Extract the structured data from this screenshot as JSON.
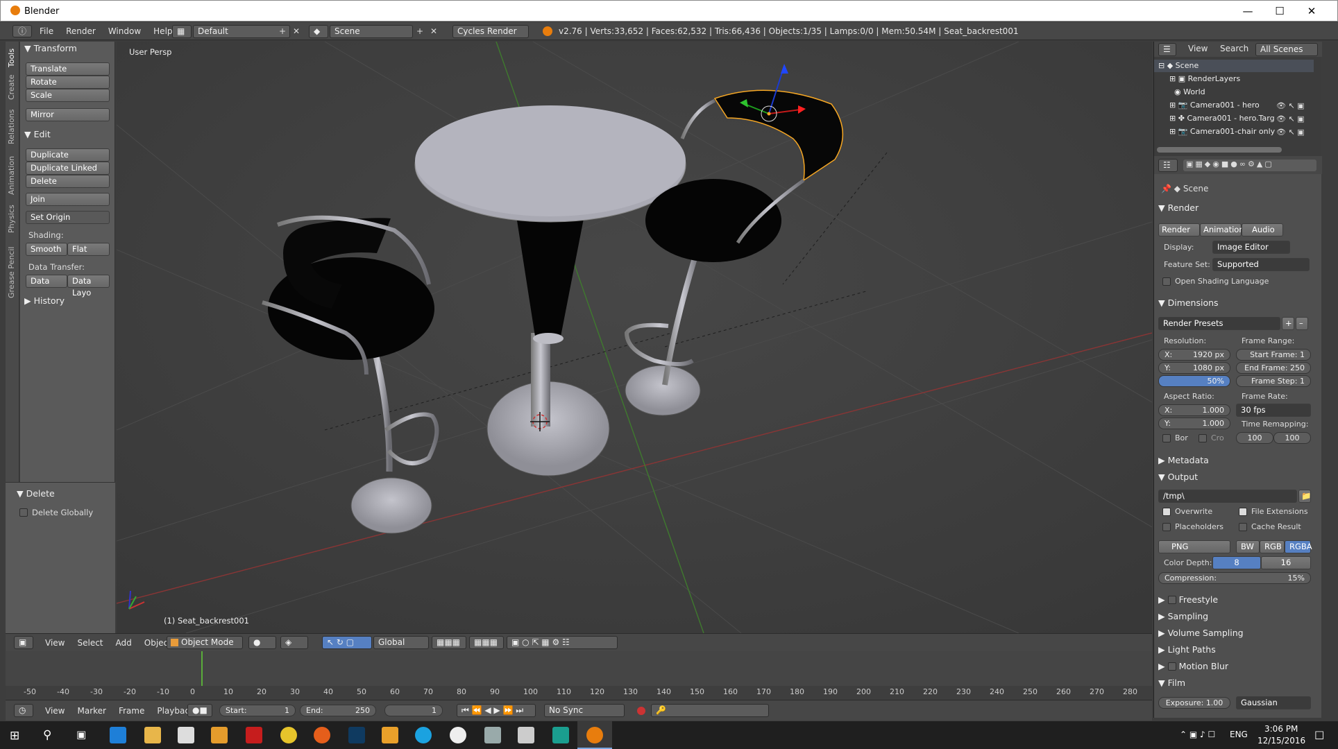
{
  "window": {
    "title": "Blender"
  },
  "infobar": {
    "menus": [
      "File",
      "Render",
      "Window",
      "Help"
    ],
    "layout": "Default",
    "scene": "Scene",
    "engine": "Cycles Render",
    "stats": "v2.76 | Verts:33,652 | Faces:62,532 | Tris:66,436 | Objects:1/35 | Lamps:0/0 | Mem:50.54M | Seat_backrest001"
  },
  "tooltabs": [
    "Tools",
    "Create",
    "Relations",
    "Animation",
    "Physics",
    "Grease Pencil"
  ],
  "toolshelf": {
    "transform": {
      "title": "Transform",
      "buttons": [
        "Translate",
        "Rotate",
        "Scale",
        "Mirror"
      ]
    },
    "edit": {
      "title": "Edit",
      "buttons": [
        "Duplicate",
        "Duplicate Linked",
        "Delete",
        "Join"
      ],
      "set_origin": "Set Origin",
      "shading_label": "Shading:",
      "smooth": "Smooth",
      "flat": "Flat",
      "data_transfer_label": "Data Transfer:",
      "data": "Data",
      "data_layo": "Data Layo"
    },
    "history": "History",
    "delete_op": {
      "title": "Delete",
      "checkbox": "Delete Globally"
    }
  },
  "viewport": {
    "view_label": "User Persp",
    "object_label": "(1) Seat_backrest001"
  },
  "view3d_header": {
    "menus": [
      "View",
      "Select",
      "Add",
      "Object"
    ],
    "mode": "Object Mode",
    "orientation": "Global"
  },
  "timeline": {
    "ticks": [
      "-50",
      "-40",
      "-30",
      "-20",
      "-10",
      "0",
      "10",
      "20",
      "30",
      "40",
      "50",
      "60",
      "70",
      "80",
      "90",
      "100",
      "110",
      "120",
      "130",
      "140",
      "150",
      "160",
      "170",
      "180",
      "190",
      "200",
      "210",
      "220",
      "230",
      "240",
      "250",
      "260",
      "270",
      "280"
    ]
  },
  "timeline_header": {
    "menus": [
      "View",
      "Marker",
      "Frame",
      "Playback"
    ],
    "start": "Start:",
    "start_val": "1",
    "end": "End:",
    "end_val": "250",
    "current": "1",
    "sync": "No Sync"
  },
  "outliner": {
    "tabs": [
      "View",
      "Search",
      "All Scenes"
    ],
    "items": [
      "Scene",
      "RenderLayers",
      "World",
      "Camera001 - hero",
      "Camera001 - hero.Targ",
      "Camera001-chair only"
    ]
  },
  "properties": {
    "context": "Scene",
    "render": {
      "title": "Render",
      "buttons": [
        "Render",
        "Animation",
        "Audio"
      ],
      "display_label": "Display:",
      "display": "Image Editor",
      "feature_label": "Feature Set:",
      "feature": "Supported",
      "osl": "Open Shading Language"
    },
    "dimensions": {
      "title": "Dimensions",
      "presets": "Render Presets",
      "resolution_label": "Resolution:",
      "res_x": "X:",
      "res_x_val": "1920 px",
      "res_y": "Y:",
      "res_y_val": "1080 px",
      "res_pct": "50%",
      "frame_range_label": "Frame Range:",
      "start_frame": "Start Frame: 1",
      "end_frame": "End Frame: 250",
      "frame_step": "Frame Step: 1",
      "aspect_label": "Aspect Ratio:",
      "asp_x": "X:",
      "asp_x_val": "1.000",
      "asp_y": "Y:",
      "asp_y_val": "1.000",
      "frame_rate_label": "Frame Rate:",
      "fps": "30 fps",
      "time_remap_label": "Time Remapping:",
      "remap_old": "100",
      "remap_new": "100",
      "bor": "Bor",
      "cro": "Cro"
    },
    "metadata": "Metadata",
    "output": {
      "title": "Output",
      "path": "/tmp\\",
      "overwrite": "Overwrite",
      "file_ext": "File Extensions",
      "placeholders": "Placeholders",
      "cache": "Cache Result",
      "format": "PNG",
      "bw": "BW",
      "rgb": "RGB",
      "rgba": "RGBA",
      "color_depth_label": "Color Depth:",
      "depth8": "8",
      "depth16": "16",
      "compression": "Compression:",
      "compression_val": "15%"
    },
    "collapsed": [
      "Freestyle",
      "Sampling",
      "Volume Sampling",
      "Light Paths",
      "Motion Blur"
    ],
    "film": {
      "title": "Film",
      "exposure": "Exposure: 1.00",
      "filter": "Gaussian"
    }
  },
  "taskbar": {
    "lang": "ENG",
    "time": "3:06 PM",
    "date": "12/15/2016"
  },
  "colors": {
    "accent": "#5680c2",
    "selection": "#f5a623",
    "header": "#474747"
  }
}
